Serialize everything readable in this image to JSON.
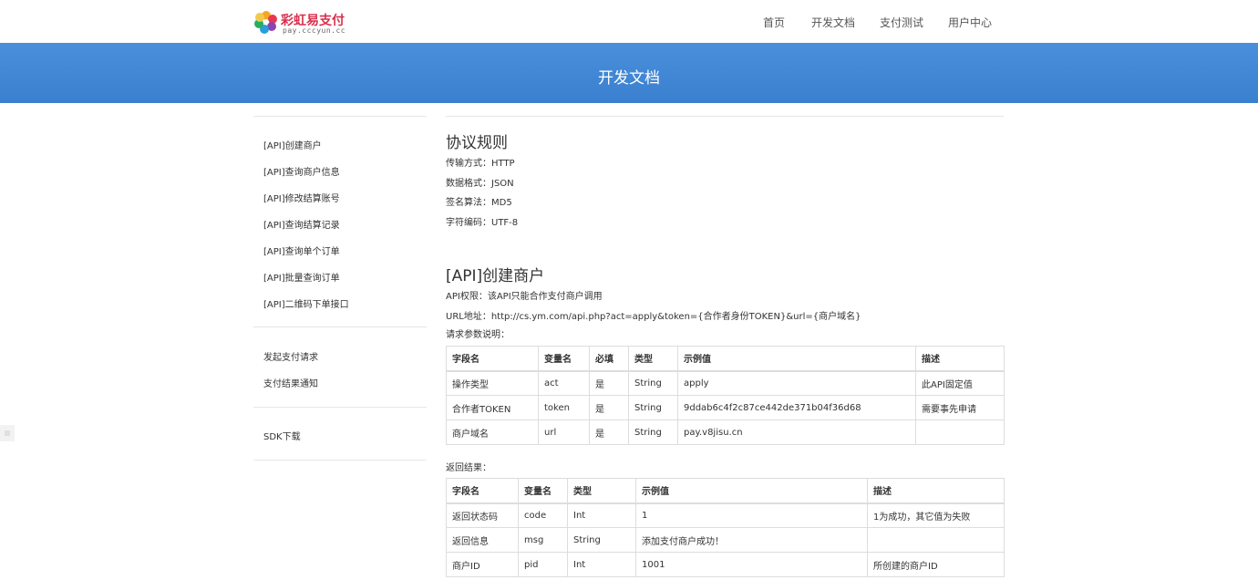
{
  "brand": {
    "title": "彩虹易支付",
    "subtitle": "pay.cccyun.cc"
  },
  "nav": {
    "home": "首页",
    "docs": "开发文档",
    "pay_test": "支付测试",
    "user_center": "用户中心"
  },
  "banner": {
    "title": "开发文档"
  },
  "sidebar": {
    "api_items": [
      "[API]创建商户",
      "[API]查询商户信息",
      "[API]修改结算账号",
      "[API]查询结算记录",
      "[API]查询单个订单",
      "[API]批量查询订单",
      "[API]二维码下单接口"
    ],
    "pay_items": [
      "发起支付请求",
      "支付结果通知"
    ],
    "sdk_items": [
      "SDK下载"
    ]
  },
  "protocol": {
    "title": "协议规则",
    "lines": [
      "传输方式：HTTP",
      "数据格式：JSON",
      "签名算法：MD5",
      "字符编码：UTF-8"
    ]
  },
  "api_create": {
    "title": "[API]创建商户",
    "permission": "API权限：该API只能合作支付商户调用",
    "url": "URL地址：http://cs.ym.com/api.php?act=apply&token={合作者身份TOKEN}&url={商户域名}",
    "request_label": "请求参数说明：",
    "request_headers": [
      "字段名",
      "变量名",
      "必填",
      "类型",
      "示例值",
      "描述"
    ],
    "request_rows": [
      [
        "操作类型",
        "act",
        "是",
        "String",
        "apply",
        "此API固定值"
      ],
      [
        "合作者TOKEN",
        "token",
        "是",
        "String",
        "9ddab6c4f2c87ce442de371b04f36d68",
        "需要事先申请"
      ],
      [
        "商户域名",
        "url",
        "是",
        "String",
        "pay.v8jisu.cn",
        ""
      ]
    ],
    "response_label": "返回结果：",
    "response_headers": [
      "字段名",
      "变量名",
      "类型",
      "示例值",
      "描述"
    ],
    "response_rows": [
      [
        "返回状态码",
        "code",
        "Int",
        "1",
        "1为成功，其它值为失败"
      ],
      [
        "返回信息",
        "msg",
        "String",
        "添加支付商户成功！",
        ""
      ],
      [
        "商户ID",
        "pid",
        "Int",
        "1001",
        "所创建的商户ID"
      ]
    ]
  }
}
